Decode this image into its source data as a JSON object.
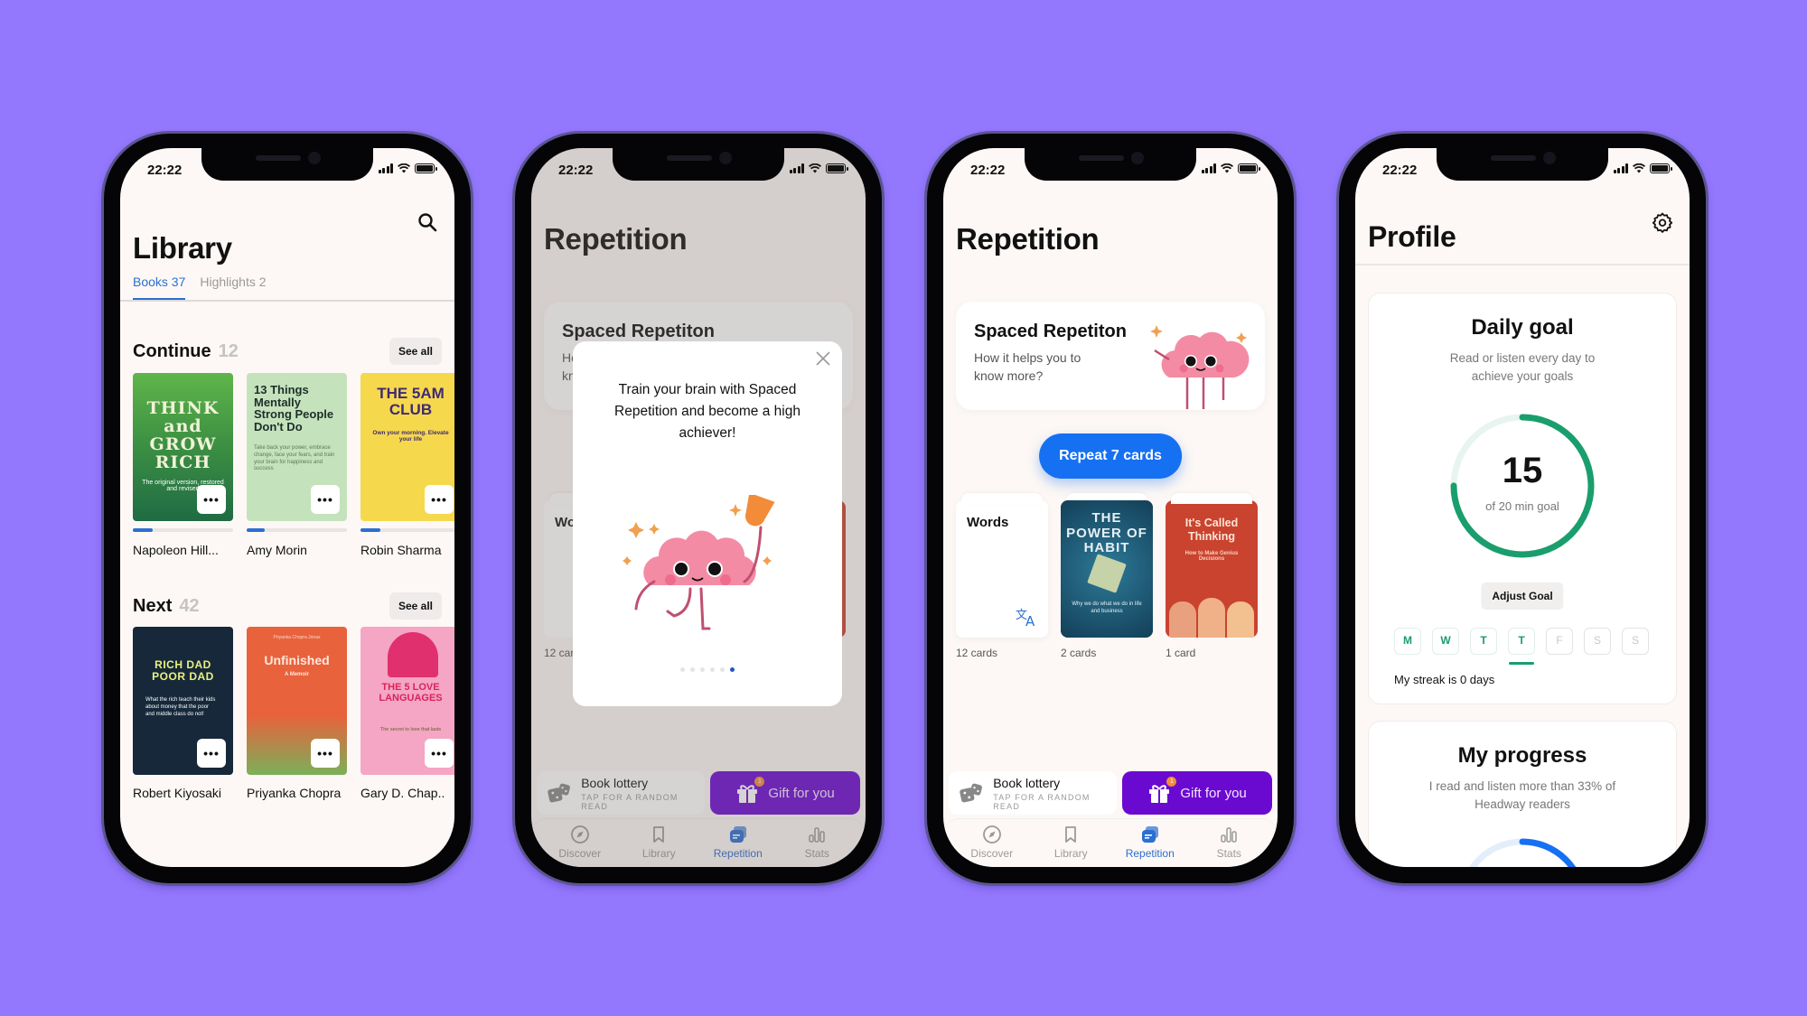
{
  "colors": {
    "background": "#9377fd",
    "accent_blue": "#2b6fd1",
    "button_blue": "#1670f2",
    "gift_purple": "#6a0ad1",
    "goal_green": "#1a9e6e"
  },
  "status_bar": {
    "time": "22:22"
  },
  "library_screen": {
    "title": "Library",
    "search_icon": "search-icon",
    "tabs": [
      {
        "label": "Books 37",
        "active": true
      },
      {
        "label": "Highlights 2",
        "active": false
      }
    ],
    "continue_section": {
      "title": "Continue",
      "count": "12",
      "see_all": "See all",
      "books": [
        {
          "cover_title": "THINK and GROW RICH",
          "cover_sub": "The original version, restored and revised",
          "author": "Napoleon Hill...",
          "progress": 0.2,
          "cover_color": "#2d7a3e"
        },
        {
          "cover_title": "13 Things Mentally Strong People Don't Do",
          "cover_sub": "Take back your power, embrace change, face your fears, and train your brain for happiness and success",
          "author": "Amy Morin",
          "progress": 0.18,
          "cover_color": "#bfe0b7"
        },
        {
          "cover_title": "THE 5AM CLUB",
          "cover_sub": "Own your morning. Elevate your life",
          "author": "Robin Sharma",
          "progress": 0.2,
          "cover_color": "#f5d54a"
        }
      ]
    },
    "next_section": {
      "title": "Next",
      "count": "42",
      "see_all": "See all",
      "books": [
        {
          "cover_title": "RICH DAD POOR DAD",
          "cover_sub": "What the rich teach their kids about money that the poor and middle class do not!",
          "author": "Robert Kiyosaki",
          "cover_color": "#16283a"
        },
        {
          "cover_title": "Unfinished",
          "cover_sub": "A Memoir",
          "cover_author": "Priyanka Chopra Jonas",
          "author": "Priyanka Chopra",
          "cover_color": "#e8623c"
        },
        {
          "cover_title": "THE 5 LOVE LANGUAGES",
          "cover_sub": "The secret to love that lasts",
          "author": "Gary D. Chap..",
          "cover_color": "#f4a6c4"
        }
      ]
    },
    "more_label": "•••"
  },
  "repetition_screen": {
    "title": "Repetition",
    "spaced_card": {
      "title": "Spaced Repetiton",
      "subtitle": "How it helps you to know more?"
    },
    "repeat_button": "Repeat 7 cards",
    "decks": [
      {
        "title": "Words",
        "count_label": "12 cards",
        "icon": "translate-icon"
      },
      {
        "title": "THE POWER OF HABIT",
        "sub": "Why we do what we do in life and business",
        "count_label": "2 cards",
        "cover_color": "#1d5a7a"
      },
      {
        "title": "It's Called Thinking",
        "sub": "How to Make Genius Decisions",
        "count_label": "1 card",
        "cover_color": "#c9432f"
      }
    ],
    "lottery": {
      "title": "Book lottery",
      "subtitle": "TAP FOR A RANDOM READ"
    },
    "gift": {
      "label": "Gift for you",
      "badge": "1"
    },
    "modal": {
      "text": "Train your brain with Spaced Repetition and become a high achiever!",
      "pages": 6,
      "current_page": 6
    }
  },
  "tab_bar": [
    {
      "label": "Discover",
      "icon": "compass-icon"
    },
    {
      "label": "Library",
      "icon": "bookmark-icon"
    },
    {
      "label": "Repetition",
      "icon": "cards-icon",
      "active": true
    },
    {
      "label": "Stats",
      "icon": "bar-chart-icon"
    }
  ],
  "profile_screen": {
    "title": "Profile",
    "daily_goal": {
      "title": "Daily goal",
      "subtitle": "Read or listen every day to achieve your goals",
      "value": "15",
      "caption": "of 20 min goal",
      "progress_fraction": 0.75,
      "adjust_button": "Adjust Goal",
      "days": [
        {
          "label": "M",
          "done": true
        },
        {
          "label": "W",
          "done": true
        },
        {
          "label": "T",
          "done": true
        },
        {
          "label": "T",
          "done": true,
          "today": true
        },
        {
          "label": "F",
          "done": false
        },
        {
          "label": "S",
          "done": false
        },
        {
          "label": "S",
          "done": false
        }
      ],
      "streak": "My streak is 0 days"
    },
    "my_progress": {
      "title": "My progress",
      "subtitle": "I read and listen more than 33% of Headway readers",
      "percent": 33
    }
  }
}
